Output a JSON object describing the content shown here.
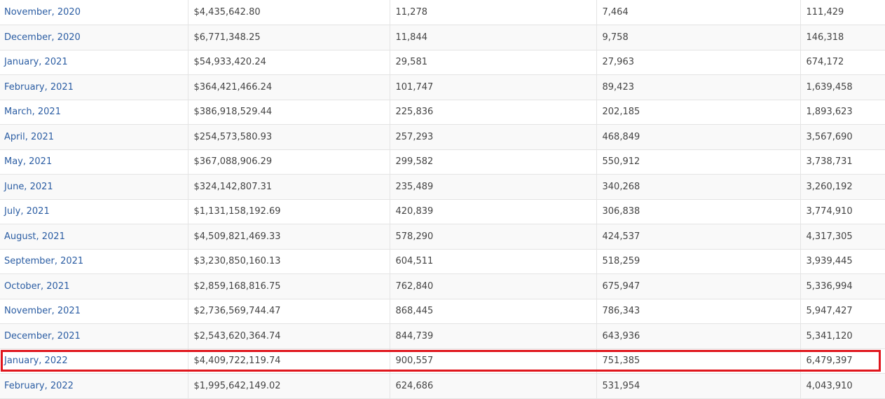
{
  "table": {
    "rows": [
      {
        "month": "November, 2020",
        "value": "$4,435,642.80",
        "col3": "11,278",
        "col4": "7,464",
        "col5": "111,429"
      },
      {
        "month": "December, 2020",
        "value": "$6,771,348.25",
        "col3": "11,844",
        "col4": "9,758",
        "col5": "146,318"
      },
      {
        "month": "January, 2021",
        "value": "$54,933,420.24",
        "col3": "29,581",
        "col4": "27,963",
        "col5": "674,172"
      },
      {
        "month": "February, 2021",
        "value": "$364,421,466.24",
        "col3": "101,747",
        "col4": "89,423",
        "col5": "1,639,458"
      },
      {
        "month": "March, 2021",
        "value": "$386,918,529.44",
        "col3": "225,836",
        "col4": "202,185",
        "col5": "1,893,623"
      },
      {
        "month": "April, 2021",
        "value": "$254,573,580.93",
        "col3": "257,293",
        "col4": "468,849",
        "col5": "3,567,690"
      },
      {
        "month": "May, 2021",
        "value": "$367,088,906.29",
        "col3": "299,582",
        "col4": "550,912",
        "col5": "3,738,731"
      },
      {
        "month": "June, 2021",
        "value": "$324,142,807.31",
        "col3": "235,489",
        "col4": "340,268",
        "col5": "3,260,192"
      },
      {
        "month": "July, 2021",
        "value": "$1,131,158,192.69",
        "col3": "420,839",
        "col4": "306,838",
        "col5": "3,774,910"
      },
      {
        "month": "August, 2021",
        "value": "$4,509,821,469.33",
        "col3": "578,290",
        "col4": "424,537",
        "col5": "4,317,305"
      },
      {
        "month": "September, 2021",
        "value": "$3,230,850,160.13",
        "col3": "604,511",
        "col4": "518,259",
        "col5": "3,939,445"
      },
      {
        "month": "October, 2021",
        "value": "$2,859,168,816.75",
        "col3": "762,840",
        "col4": "675,947",
        "col5": "5,336,994"
      },
      {
        "month": "November, 2021",
        "value": "$2,736,569,744.47",
        "col3": "868,445",
        "col4": "786,343",
        "col5": "5,947,427"
      },
      {
        "month": "December, 2021",
        "value": "$2,543,620,364.74",
        "col3": "844,739",
        "col4": "643,936",
        "col5": "5,341,120"
      },
      {
        "month": "January, 2022",
        "value": "$4,409,722,119.74",
        "col3": "900,557",
        "col4": "751,385",
        "col5": "6,479,397"
      },
      {
        "month": "February, 2022",
        "value": "$1,995,642,149.02",
        "col3": "624,686",
        "col4": "531,954",
        "col5": "4,043,910"
      }
    ],
    "highlighted_row": "January, 2022",
    "colors": {
      "link": "#2b5da3",
      "text": "#444444",
      "border": "#e4e4e4",
      "stripe": "#f9f9f9",
      "highlight": "#e0161d"
    }
  }
}
